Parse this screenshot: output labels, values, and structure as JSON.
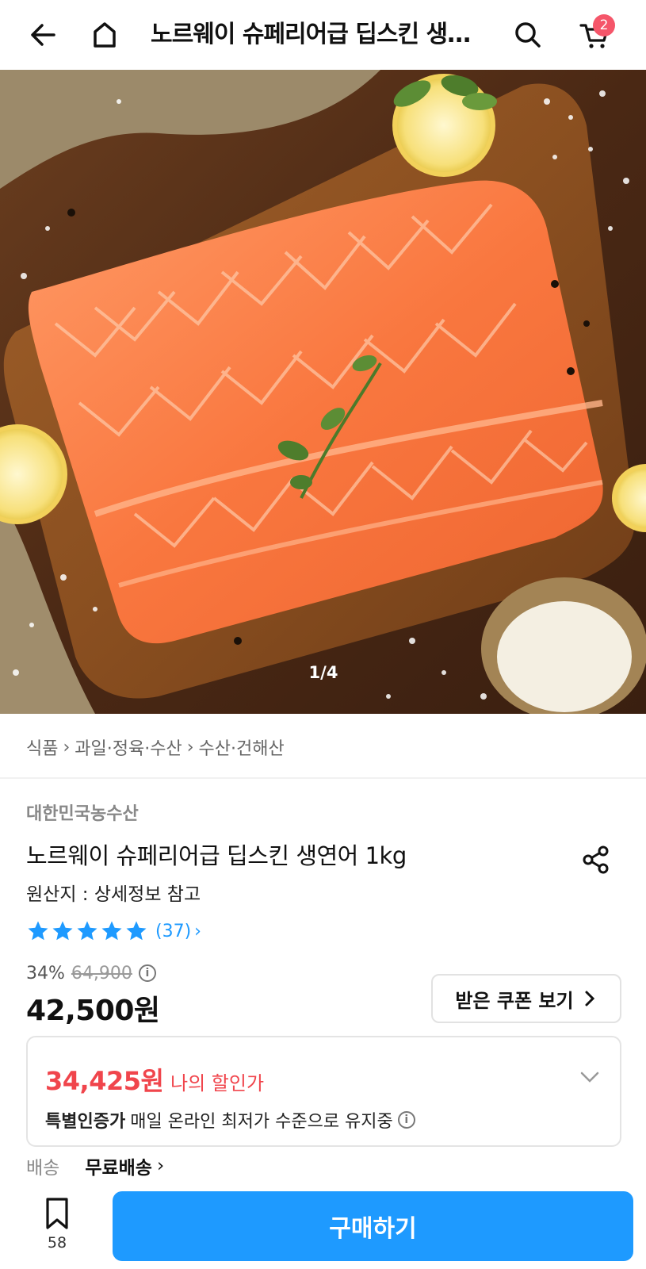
{
  "header": {
    "title": "노르웨이 슈페리어급 딥스킨 생…",
    "cart_count": "2"
  },
  "gallery": {
    "pager": "1/4"
  },
  "breadcrumb": [
    "식품",
    "과일·정육·수산",
    "수산·건해산"
  ],
  "product": {
    "brand": "대한민국농수산",
    "title": "노르웨이 슈페리어급 딥스킨 생연어 1kg",
    "origin": "원산지 : 상세정보 참고",
    "rating": 5,
    "review_count": "(37)",
    "discount_rate": "34%",
    "original_price": "64,900",
    "price": "42,500원",
    "coupon_label": "받은 쿠폰 보기"
  },
  "benefit": {
    "price": "34,425원",
    "label": "나의 할인가",
    "note_bold": "특별인증가",
    "note_text": "매일 온라인 최저가 수준으로 유지중"
  },
  "delivery": {
    "label": "배송",
    "value": "무료배송"
  },
  "bottom": {
    "bookmark_count": "58",
    "buy_label": "구매하기"
  },
  "colors": {
    "accent": "#1e9aff",
    "sale": "#f0454c",
    "badge": "#f5566a"
  }
}
